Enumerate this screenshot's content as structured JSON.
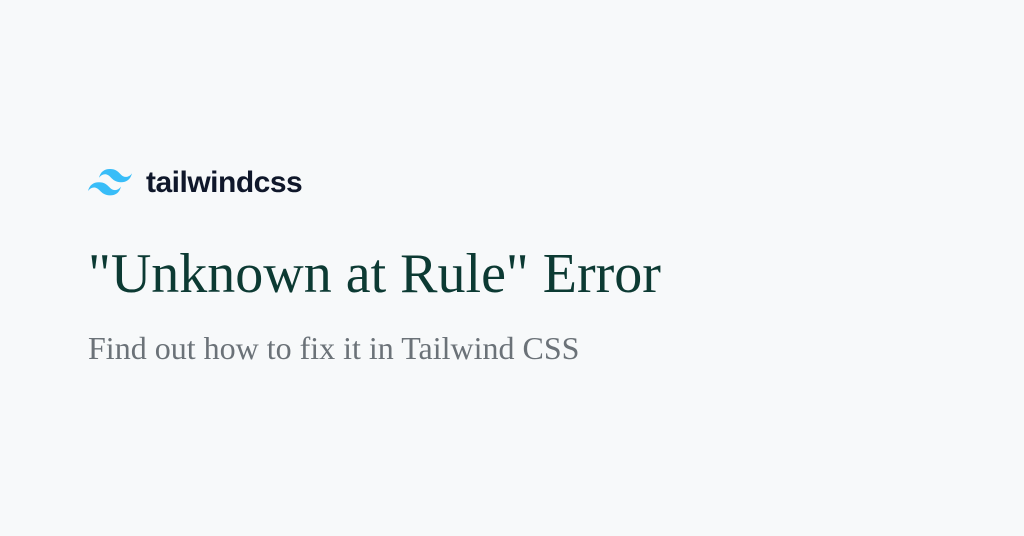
{
  "brand": {
    "name": "tailwindcss",
    "icon_name": "tailwindcss-logo-icon"
  },
  "heading": "\"Unknown at Rule\" Error",
  "subheading": "Find out how to fix it in Tailwind CSS",
  "colors": {
    "background": "#f7f9fa",
    "heading": "#0c3a33",
    "subheading": "#6b7278",
    "logo_text": "#0f172a",
    "logo_icon": "#38bdf8"
  }
}
